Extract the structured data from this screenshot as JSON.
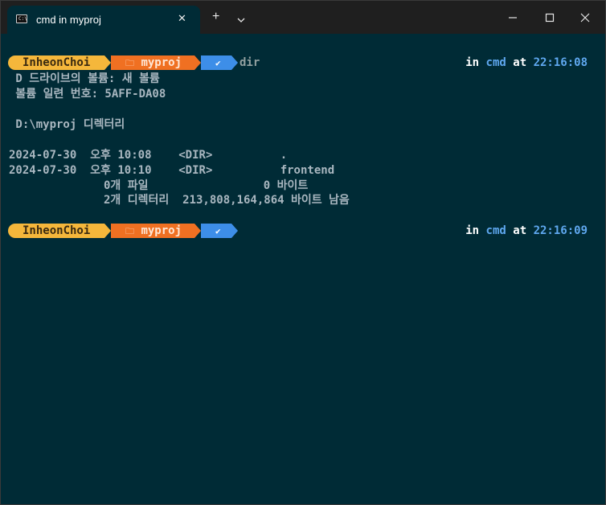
{
  "tab": {
    "title": "cmd in myproj",
    "icon": "terminal-icon",
    "icon_glyph": "C:\\"
  },
  "titlebar": {
    "new_tab": "+",
    "minimize": "minimize-icon",
    "maximize": "maximize-icon",
    "close": "close-icon"
  },
  "colors": {
    "user": "#f5b73b",
    "folder": "#f07022",
    "status": "#3d8ee8",
    "background": "#002b36"
  },
  "prompts": [
    {
      "user": "InheonChoi",
      "folder_icon": "🗀",
      "folder": "myproj",
      "status": "✔",
      "command": "dir",
      "in": "in",
      "shell": "cmd",
      "at": "at",
      "time": "22:16:08"
    },
    {
      "user": "InheonChoi",
      "folder_icon": "🗀",
      "folder": "myproj",
      "status": "✔",
      "command": "",
      "in": "in",
      "shell": "cmd",
      "at": "at",
      "time": "22:16:09"
    }
  ],
  "output": {
    "volume_label": " D 드라이브의 볼륨: 새 볼륨",
    "volume_serial": " 볼륨 일련 번호: 5AFF-DA08",
    "directory_of": " D:\\myproj 디렉터리",
    "entries": [
      {
        "date": "2024-07-30",
        "ampm": "오후",
        "time": "10:08",
        "type": "<DIR>",
        "name": "."
      },
      {
        "date": "2024-07-30",
        "ampm": "오후",
        "time": "10:10",
        "type": "<DIR>",
        "name": "frontend"
      }
    ],
    "files_summary": "              0개 파일                 0 바이트",
    "dirs_summary": "              2개 디렉터리  213,808,164,864 바이트 남음"
  }
}
